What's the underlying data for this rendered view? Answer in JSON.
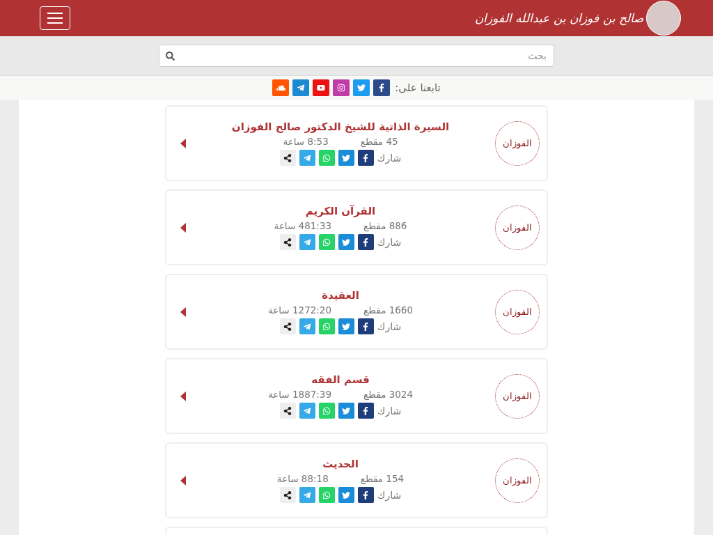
{
  "header": {
    "logo_text": "صالح بن فوزان بن عبدالله الفوزان"
  },
  "search": {
    "placeholder": "بحث"
  },
  "follow": {
    "label": "تابعنا على:",
    "links": [
      {
        "kind": "facebook"
      },
      {
        "kind": "twitter"
      },
      {
        "kind": "instagram"
      },
      {
        "kind": "youtube"
      },
      {
        "kind": "telegram"
      },
      {
        "kind": "soundcloud"
      }
    ]
  },
  "cards": [
    {
      "logo_text": "الفوزان",
      "title": "السيرة الذاتية للشيخ الدكتور صالح الفوزان",
      "clips": "45 مقطع",
      "duration": "8:53 ساعة",
      "share_label": "شارك",
      "share": [
        {
          "kind": "facebook"
        },
        {
          "kind": "twitter"
        },
        {
          "kind": "whatsapp"
        },
        {
          "kind": "telegram"
        },
        {
          "kind": "share"
        }
      ]
    },
    {
      "logo_text": "الفوزان",
      "title": "القرآن الكريم",
      "clips": "886 مقطع",
      "duration": "481:33 ساعة",
      "share_label": "شارك",
      "share": [
        {
          "kind": "facebook"
        },
        {
          "kind": "twitter"
        },
        {
          "kind": "whatsapp"
        },
        {
          "kind": "telegram"
        },
        {
          "kind": "share"
        }
      ]
    },
    {
      "logo_text": "الفوزان",
      "title": "العقيدة",
      "clips": "1660 مقطع",
      "duration": "1272:20 ساعة",
      "share_label": "شارك",
      "share": [
        {
          "kind": "facebook"
        },
        {
          "kind": "twitter"
        },
        {
          "kind": "whatsapp"
        },
        {
          "kind": "telegram"
        },
        {
          "kind": "share"
        }
      ]
    },
    {
      "logo_text": "الفوزان",
      "title": "قسم الفقه",
      "clips": "3024 مقطع",
      "duration": "1887:39 ساعة",
      "share_label": "شارك",
      "share": [
        {
          "kind": "facebook"
        },
        {
          "kind": "twitter"
        },
        {
          "kind": "whatsapp"
        },
        {
          "kind": "telegram"
        },
        {
          "kind": "share"
        }
      ]
    },
    {
      "logo_text": "الفوزان",
      "title": "الحديث",
      "clips": "154 مقطع",
      "duration": "88:18 ساعة",
      "share_label": "شارك",
      "share": [
        {
          "kind": "facebook"
        },
        {
          "kind": "twitter"
        },
        {
          "kind": "whatsapp"
        },
        {
          "kind": "telegram"
        },
        {
          "kind": "share"
        }
      ]
    }
  ],
  "more_below": true
}
